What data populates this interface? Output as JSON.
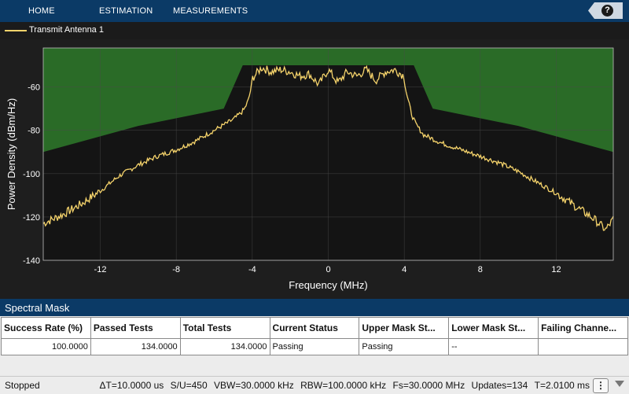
{
  "toolstrip": {
    "tabs": [
      "HOME",
      "ESTIMATION",
      "MEASUREMENTS"
    ],
    "help_icon": "help-icon",
    "help_glyph": "?"
  },
  "legend": {
    "entries": [
      {
        "name": "Transmit Antenna 1",
        "color": "#f5d36b"
      }
    ]
  },
  "chart_data": {
    "type": "line",
    "xlabel": "Frequency (MHz)",
    "ylabel": "Power Density (dBm/Hz)",
    "xlim": [
      -15,
      15
    ],
    "ylim": [
      -140,
      -42
    ],
    "xticks": [
      -12,
      -8,
      -4,
      0,
      4,
      8,
      12
    ],
    "yticks": [
      -140,
      -120,
      -100,
      -80,
      -60
    ],
    "grid": true,
    "colors": {
      "background": "#141414",
      "mask_region": "#2a6b27",
      "trace": "#f5d36b"
    },
    "mask_upper_limit": {
      "x": [
        -15,
        -10,
        -5.5,
        -4.5,
        4.5,
        5.5,
        10,
        15
      ],
      "y": [
        -90,
        -78,
        -70,
        -50,
        -50,
        -70,
        -78,
        -90
      ]
    },
    "series": [
      {
        "name": "Transmit Antenna 1",
        "x": [
          -15,
          -14,
          -13,
          -12,
          -11,
          -10,
          -9,
          -8,
          -7,
          -6,
          -5,
          -4.6,
          -4.4,
          -4.2,
          -4.05,
          -4,
          -3.5,
          -3,
          -2.5,
          -2,
          -1.5,
          -1,
          -0.5,
          0,
          0.5,
          1,
          1.5,
          2,
          2.5,
          3,
          3.5,
          4,
          4.05,
          4.2,
          4.4,
          4.6,
          5,
          6,
          7,
          8,
          9,
          10,
          11,
          12,
          13,
          14,
          14.6,
          15
        ],
        "y": [
          -123,
          -119,
          -114,
          -108,
          -101,
          -96,
          -92,
          -89,
          -85,
          -80,
          -75,
          -72,
          -70,
          -66,
          -60,
          -56,
          -51,
          -53,
          -52,
          -53,
          -55,
          -54,
          -59,
          -52,
          -58,
          -53,
          -55,
          -52,
          -57,
          -53,
          -52,
          -55,
          -60,
          -66,
          -73,
          -77,
          -82,
          -86,
          -89,
          -92,
          -95,
          -99,
          -104,
          -109,
          -115,
          -121,
          -126,
          -121
        ]
      }
    ]
  },
  "spectral_mask": {
    "title": "Spectral Mask",
    "columns": [
      "Success Rate (%)",
      "Passed Tests",
      "Total Tests",
      "Current Status",
      "Upper Mask St...",
      "Lower Mask St...",
      "Failing Channe..."
    ],
    "rows": [
      [
        "100.0000",
        "134.0000",
        "134.0000",
        "Passing",
        "Passing",
        "--",
        ""
      ]
    ]
  },
  "status": {
    "state": "Stopped",
    "delta_t": "ΔT=10.0000 us",
    "su": "S/U=450",
    "vbw": "VBW=30.0000 kHz",
    "rbw": "RBW=100.0000 kHz",
    "fs": "Fs=30.0000 MHz",
    "updates": "Updates=134",
    "t": "T=2.0100 ms",
    "menu_glyph": "⋮"
  }
}
